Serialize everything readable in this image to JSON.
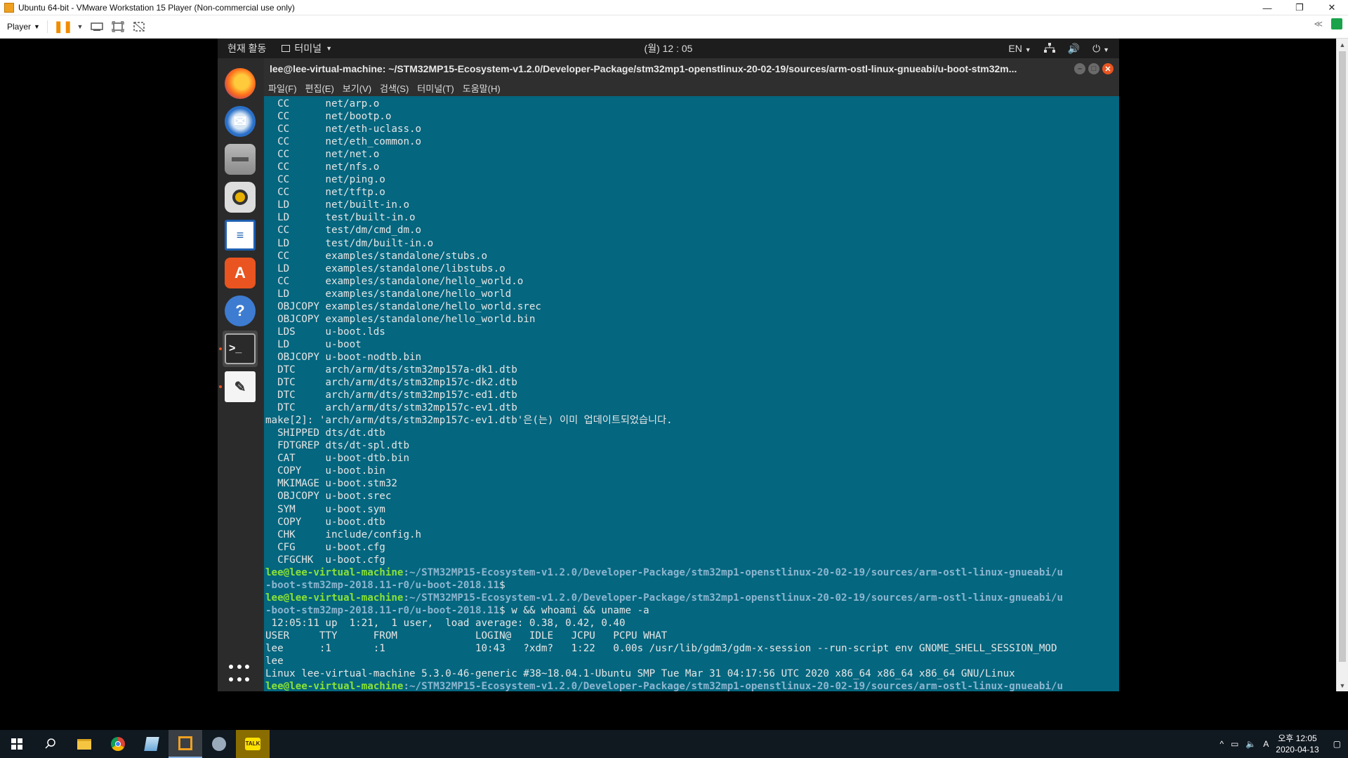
{
  "host": {
    "title": "Ubuntu 64-bit - VMware Workstation 15 Player (Non-commercial use only)",
    "player_menu": "Player",
    "win_controls": [
      "—",
      "❐",
      "✕"
    ]
  },
  "gnome": {
    "activities": "현재 활동",
    "app_menu": "터미널",
    "clock": "(월) 12 : 05",
    "lang": "EN"
  },
  "terminal": {
    "title": "lee@lee-virtual-machine: ~/STM32MP15-Ecosystem-v1.2.0/Developer-Package/stm32mp1-openstlinux-20-02-19/sources/arm-ostl-linux-gnueabi/u-boot-stm32m...",
    "menu": [
      "파일(F)",
      "편집(E)",
      "보기(V)",
      "검색(S)",
      "터미널(T)",
      "도움말(H)"
    ],
    "lines": [
      "  CC      net/arp.o",
      "  CC      net/bootp.o",
      "  CC      net/eth-uclass.o",
      "  CC      net/eth_common.o",
      "  CC      net/net.o",
      "  CC      net/nfs.o",
      "  CC      net/ping.o",
      "  CC      net/tftp.o",
      "  LD      net/built-in.o",
      "  LD      test/built-in.o",
      "  CC      test/dm/cmd_dm.o",
      "  LD      test/dm/built-in.o",
      "  CC      examples/standalone/stubs.o",
      "  LD      examples/standalone/libstubs.o",
      "  CC      examples/standalone/hello_world.o",
      "  LD      examples/standalone/hello_world",
      "  OBJCOPY examples/standalone/hello_world.srec",
      "  OBJCOPY examples/standalone/hello_world.bin",
      "  LDS     u-boot.lds",
      "  LD      u-boot",
      "  OBJCOPY u-boot-nodtb.bin",
      "  DTC     arch/arm/dts/stm32mp157a-dk1.dtb",
      "  DTC     arch/arm/dts/stm32mp157c-dk2.dtb",
      "  DTC     arch/arm/dts/stm32mp157c-ed1.dtb",
      "  DTC     arch/arm/dts/stm32mp157c-ev1.dtb",
      "make[2]: 'arch/arm/dts/stm32mp157c-ev1.dtb'은(는) 이미 업데이트되었습니다.",
      "  SHIPPED dts/dt.dtb",
      "  FDTGREP dts/dt-spl.dtb",
      "  CAT     u-boot-dtb.bin",
      "  COPY    u-boot.bin",
      "  MKIMAGE u-boot.stm32",
      "  OBJCOPY u-boot.srec",
      "  SYM     u-boot.sym",
      "  COPY    u-boot.dtb",
      "  CHK     include/config.h",
      "  CFG     u-boot.cfg",
      "  CFGCHK  u-boot.cfg"
    ],
    "prompt_user": "lee@lee-virtual-machine",
    "prompt_path1": ":~/STM32MP15-Ecosystem-v1.2.0/Developer-Package/stm32mp1-openstlinux-20-02-19/sources/arm-ostl-linux-gnueabi/u",
    "prompt_path2": "-boot-stm32mp-2018.11-r0/u-boot-2018.11",
    "prompt_end1": "$ ",
    "prompt_end2": "$ w && whoami && uname -a",
    "output": [
      " 12:05:11 up  1:21,  1 user,  load average: 0.38, 0.42, 0.40",
      "USER     TTY      FROM             LOGIN@   IDLE   JCPU   PCPU WHAT",
      "lee      :1       :1               10:43   ?xdm?   1:22   0.00s /usr/lib/gdm3/gdm-x-session --run-script env GNOME_SHELL_SESSION_MOD",
      "lee",
      "Linux lee-virtual-machine 5.3.0-46-generic #38~18.04.1-Ubuntu SMP Tue Mar 31 04:17:56 UTC 2020 x86_64 x86_64 x86_64 GNU/Linux"
    ],
    "last_prompt_path": ":~/STM32MP15-Ecosystem-v1.2.0/Developer-Package/stm32mp1-openstlinux-20-02-19/sources/arm-ostl-linux-gnueabi/u"
  },
  "taskbar": {
    "time": "오후 12:05",
    "date": "2020-04-13",
    "ime": "A"
  }
}
